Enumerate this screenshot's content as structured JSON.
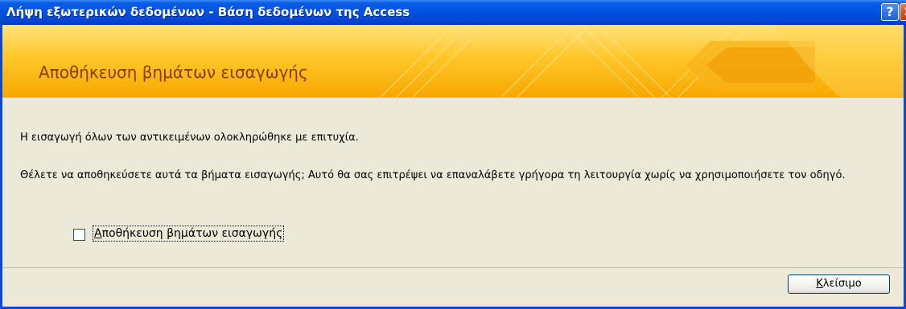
{
  "window": {
    "title": "Λήψη εξωτερικών δεδομένων - Βάση δεδομένων της Access",
    "help_glyph": "?",
    "close_glyph": "✕"
  },
  "banner": {
    "title": "Αποθήκευση βημάτων εισαγωγής"
  },
  "content": {
    "message_success": "Η εισαγωγή όλων των αντικειμένων ολοκληρώθηκε με επιτυχία.",
    "message_question": "Θέλετε να αποθηκεύσετε αυτά τα βήματα εισαγωγής; Αυτό θα σας επιτρέψει να επαναλάβετε γρήγορα τη λειτουργία χωρίς να χρησιμοποιήσετε τον οδηγό.",
    "checkbox_label_first": "Α",
    "checkbox_label_rest": "ποθήκευση βημάτων εισαγωγής",
    "checkbox_checked": false
  },
  "footer": {
    "close_label_first": "Κ",
    "close_label_rest": "λείσιμο"
  },
  "colors": {
    "title_bar": "#0054E3",
    "banner_top": "#FFE27A",
    "banner_bottom": "#F6A800",
    "banner_text": "#8B3A00",
    "dialog_bg": "#ECE9D8"
  }
}
